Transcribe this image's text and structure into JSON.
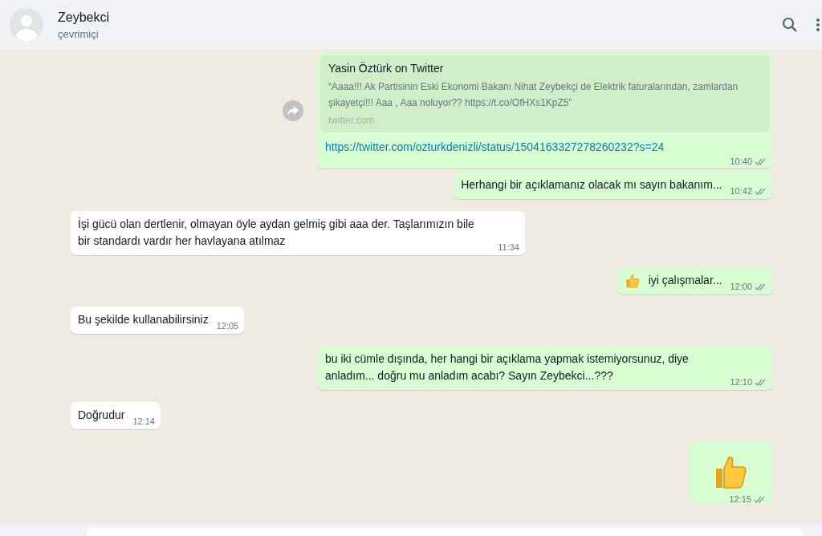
{
  "header": {
    "name": "Zeybekci",
    "status": "çevrimiçi"
  },
  "messages": [
    {
      "kind": "link",
      "outgoing": true,
      "forwardable": true,
      "preview": {
        "title": "Yasin Öztürk on Twitter",
        "description": "“Aaaa!!! Ak Partisinin Eski Ekonomi Bakanı Nihat Zeybekçi de Elektrik faturalarından, zamlardan şikayetçi!!! Aaa , Aaa noluyor?? https://t.co/OfHXs1KpZ5”",
        "domain": "twitter.com"
      },
      "text": "https://twitter.com/ozturkdenizli/status/1504163327278260232?s=24",
      "time": "10:40"
    },
    {
      "kind": "text",
      "outgoing": true,
      "text": "Herhangi bir açıklamanız olacak mı sayın bakanım...",
      "time": "10:42"
    },
    {
      "kind": "text",
      "outgoing": false,
      "text": "İşi gücü olan dertlenir, olmayan öyle aydan gelmiş gibi aaa der. Taşlarımızın bile bir standardı vardır her havlayana atılmaz",
      "time": "11:34"
    },
    {
      "kind": "emoji_text",
      "outgoing": true,
      "text": "iyi çalışmalar...",
      "time": "12:00"
    },
    {
      "kind": "text",
      "outgoing": false,
      "text": "Bu şekilde kullanabilirsiniz",
      "time": "12:05"
    },
    {
      "kind": "text",
      "outgoing": true,
      "text": "bu iki cümle dışında, her hangi bir açıklama yapmak istemiyorsunuz, diye anladım... doğru mu anladım acabı? Sayın Zeybekci...???",
      "time": "12:10"
    },
    {
      "kind": "text",
      "outgoing": false,
      "text": "Doğrudur",
      "time": "12:14"
    },
    {
      "kind": "emoji_only",
      "outgoing": true,
      "time": "12:15"
    }
  ]
}
